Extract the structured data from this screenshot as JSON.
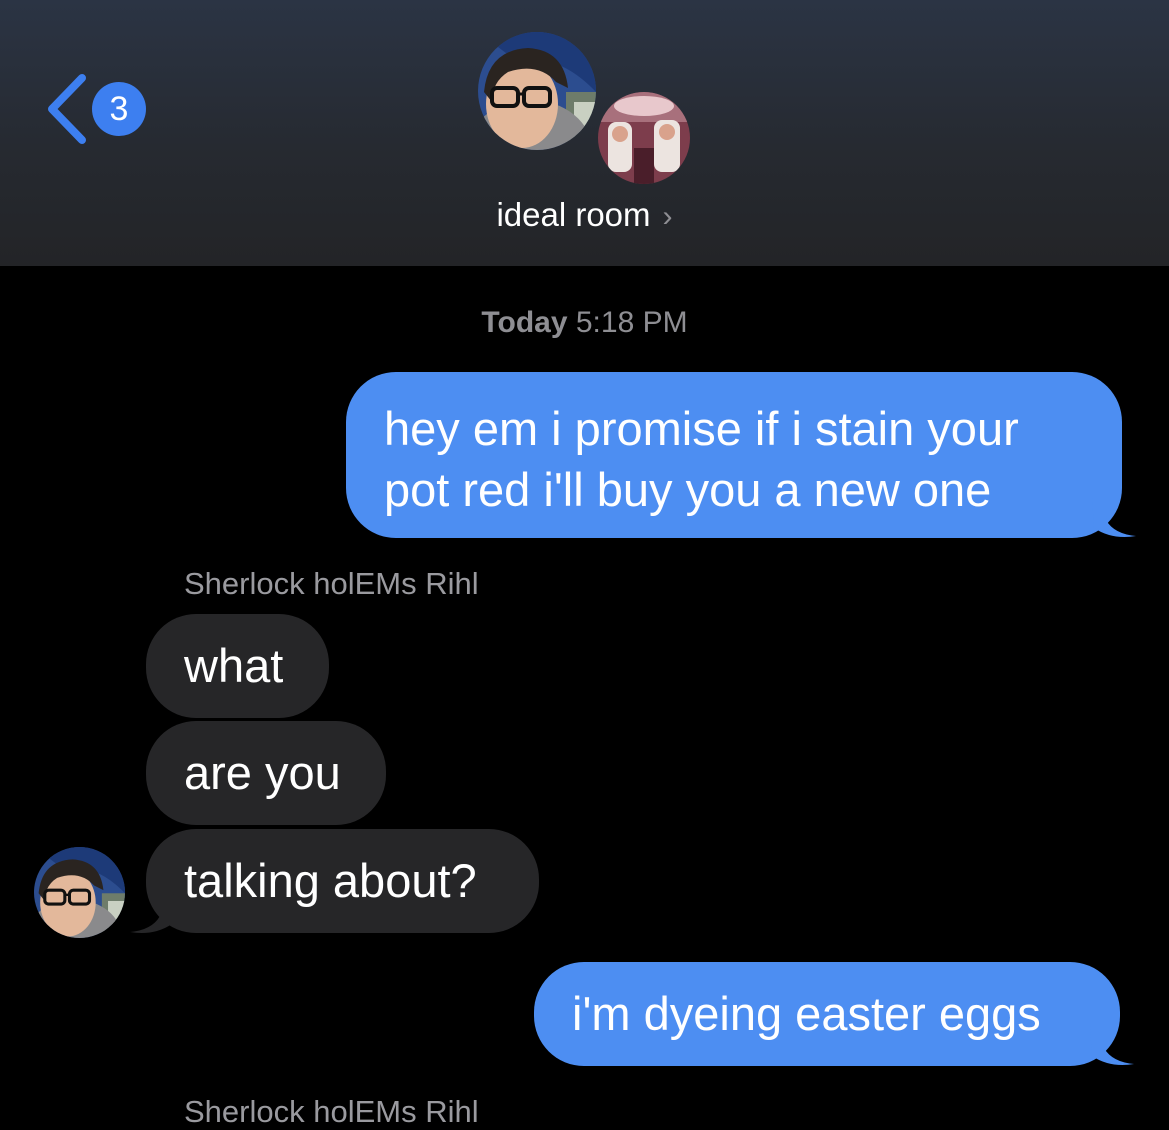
{
  "header": {
    "back_badge": "3",
    "title": "ideal room",
    "title_chevron": "›"
  },
  "timestamp": {
    "day": "Today",
    "time": "5:18 PM"
  },
  "messages": [
    {
      "direction": "sent",
      "text": "hey em i promise if i stain your pot red i'll buy you a new one"
    },
    {
      "direction": "received",
      "sender": "Sherlock holEMs Rihl",
      "text": "what"
    },
    {
      "direction": "received",
      "text": "are you"
    },
    {
      "direction": "received",
      "text": "talking about?"
    },
    {
      "direction": "sent",
      "text": "i'm dyeing easter eggs"
    }
  ],
  "next_sender": "Sherlock holEMs Rihl",
  "colors": {
    "sent_bubble": "#4d8ef2",
    "received_bubble": "#262628",
    "accent": "#3d7ff0",
    "background": "#000000"
  },
  "icons": [
    "back-chevron-icon",
    "title-chevron-icon"
  ]
}
